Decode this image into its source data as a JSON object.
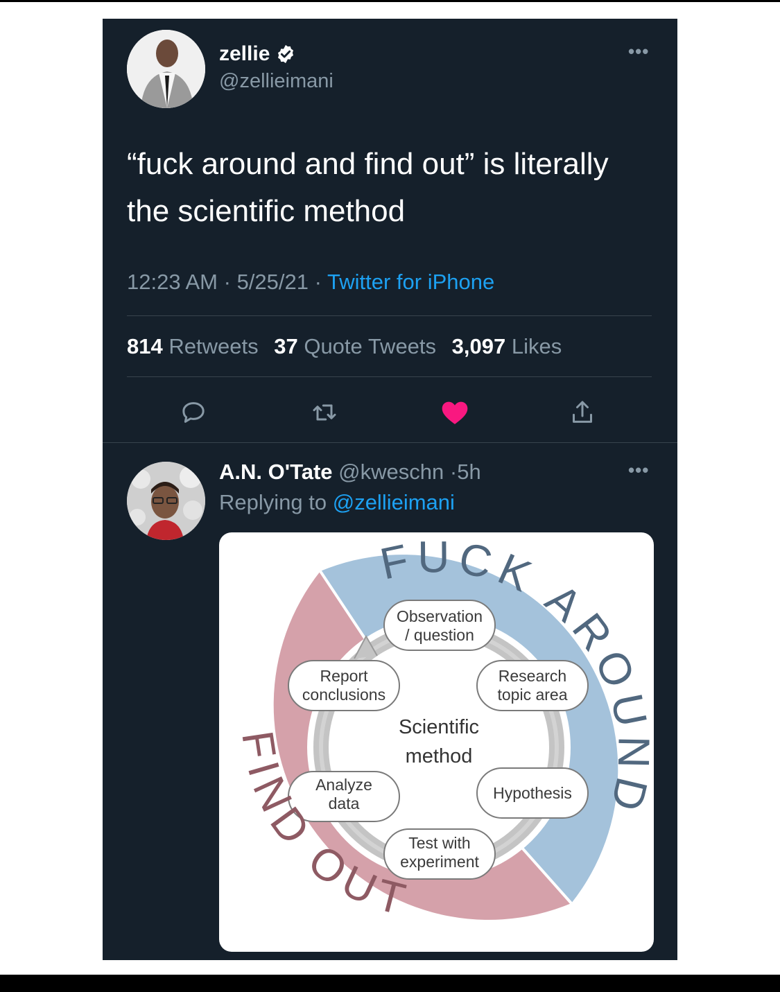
{
  "tweet": {
    "author_name": "zellie",
    "author_handle": "@zellieimani",
    "text": "“fuck around and find out” is literally the scientific method",
    "time": "12:23 AM",
    "date": "5/25/21",
    "separator": "·",
    "source": "Twitter for iPhone",
    "stats": {
      "retweets_count": "814",
      "retweets_label": "Retweets",
      "quotes_count": "37",
      "quotes_label": "Quote Tweets",
      "likes_count": "3,097",
      "likes_label": "Likes"
    },
    "more_glyph": "•••"
  },
  "reply": {
    "author_name": "A.N. O'Tate",
    "author_handle": "@kweschn",
    "separator": "·",
    "age": "5h",
    "replying_prefix": "Replying to",
    "replying_to": "@zellieimani",
    "more_glyph": "•••"
  },
  "diagram": {
    "outer_top": "FUCK AROUND",
    "outer_bottom": "FIND OUT",
    "center_line1": "Scientific",
    "center_line2": "method",
    "steps": [
      {
        "line1": "Observation",
        "line2": "/ question"
      },
      {
        "line1": "Research",
        "line2": "topic area"
      },
      {
        "line1": "Hypothesis",
        "line2": ""
      },
      {
        "line1": "Test with",
        "line2": "experiment"
      },
      {
        "line1": "Analyze",
        "line2": "data"
      },
      {
        "line1": "Report",
        "line2": "conclusions"
      }
    ]
  },
  "colors": {
    "background": "#15202b",
    "primary_text": "#ffffff",
    "secondary_text": "#8899a6",
    "link": "#1da1f2",
    "like": "#f91880",
    "divider": "#38444d",
    "ring_blue": "#a4c2db",
    "ring_red": "#d5a1aa"
  },
  "icons": {
    "verified": "verified-badge-icon",
    "reply": "reply-icon",
    "retweet": "retweet-icon",
    "like": "heart-icon",
    "share": "share-icon"
  }
}
